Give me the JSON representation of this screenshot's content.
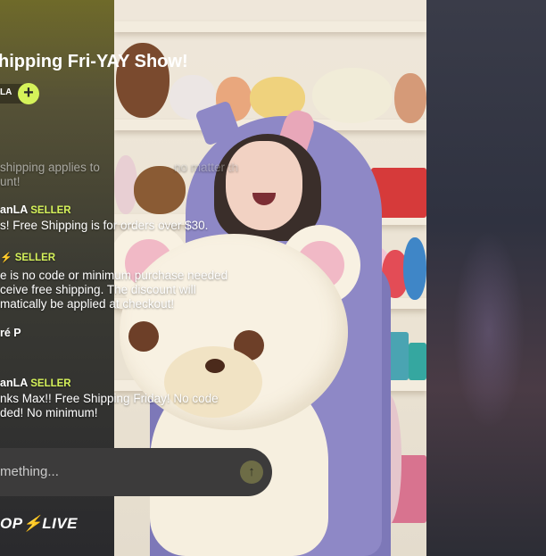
{
  "show": {
    "title": "hipping Fri-YAY Show!",
    "host_tag": "LA",
    "follow_icon": "plus-icon"
  },
  "chat": {
    "messages": [
      {
        "lines": [
          "shipping applies to",
          "unt!"
        ],
        "faded": true,
        "partial_overlay": "no matter th"
      },
      {
        "author": "anLA",
        "badge": "SELLER",
        "lines": [
          "s! Free Shipping is for orders over $30."
        ]
      },
      {
        "author": "",
        "badge": "SELLER",
        "lines": [
          "e is no code or minimum purchase needed",
          "ceive free shipping. The discount will",
          "matically be applied at checkout!"
        ]
      },
      {
        "author": "ré P",
        "lines": []
      },
      {
        "author": "anLA",
        "badge": "SELLER",
        "lines": [
          "nks Max!! Free Shipping Friday! No code",
          "ded! No minimum!"
        ]
      }
    ],
    "input_placeholder": "mething...",
    "send_icon": "arrow-up-icon"
  },
  "branding": {
    "logo_text": "OP⚡LIVE"
  },
  "colors": {
    "accent": "#d5f25a",
    "chat_bg": "#3c3b3b"
  }
}
